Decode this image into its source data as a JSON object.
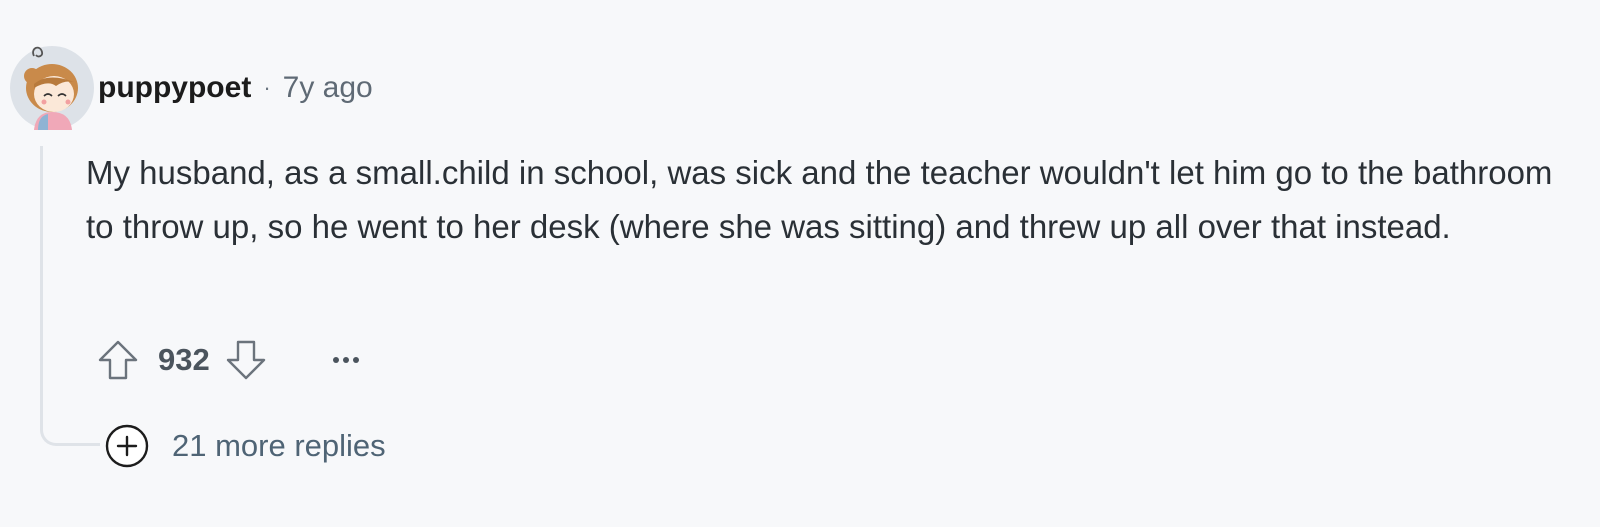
{
  "comment": {
    "author": "puppypoet",
    "separator": "·",
    "timestamp": "7y ago",
    "body": "My husband, as a small.child in school, was sick and the teacher wouldn't let him go to the bathroom to throw up, so he went to her desk (where she was sitting) and threw up all over that instead.",
    "score": "932",
    "more_icon": "ellipsis-icon",
    "more_replies_label": "21 more replies"
  },
  "colors": {
    "background": "#f7f8fa",
    "text": "#2a3036",
    "muted": "#5f6a75",
    "thread_line": "#dfe3e8"
  }
}
